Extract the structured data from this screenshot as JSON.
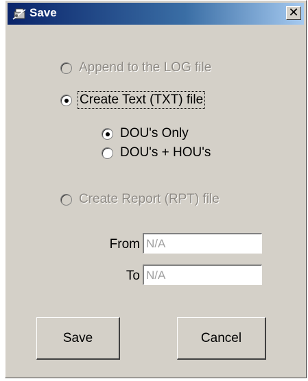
{
  "window": {
    "title": "Save",
    "close_glyph": "✕"
  },
  "options": {
    "append_log": {
      "label": "Append to the LOG file",
      "selected": false,
      "enabled": false
    },
    "create_txt": {
      "label": "Create Text (TXT) file",
      "selected": true,
      "enabled": true
    },
    "txt_sub": {
      "dou_only": {
        "label": "DOU's Only",
        "selected": true
      },
      "dou_hou": {
        "label": "DOU's + HOU's",
        "selected": false
      }
    },
    "create_rpt": {
      "label": "Create Report (RPT) file",
      "selected": false,
      "enabled": false
    }
  },
  "range": {
    "from_label": "From",
    "from_value": "N/A",
    "to_label": "To",
    "to_value": "N/A"
  },
  "buttons": {
    "save": "Save",
    "cancel": "Cancel"
  },
  "icons": {
    "title_icon": "save-dialog-icon"
  }
}
